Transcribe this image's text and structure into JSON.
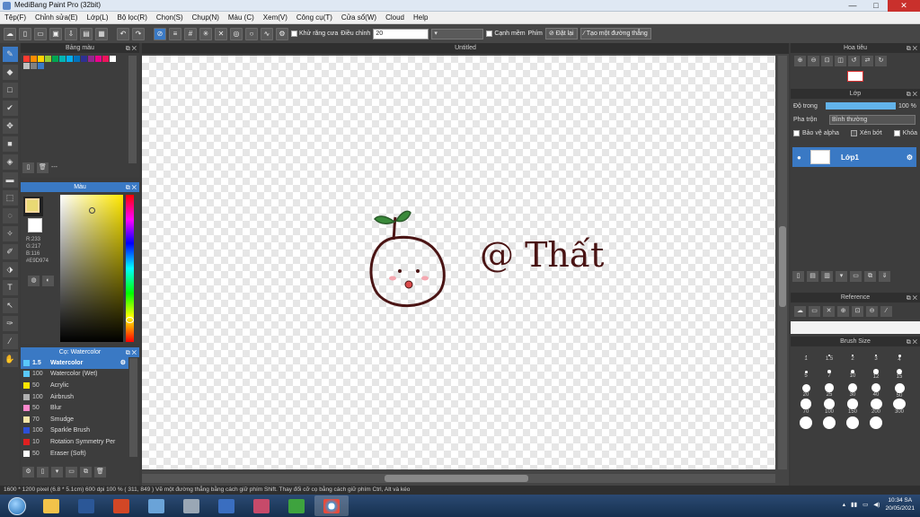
{
  "app": {
    "title": "MediBang Paint Pro (32bit)",
    "win_minimize": "—",
    "win_maximize": "□",
    "win_close": "✕"
  },
  "menu": [
    "Tệp(F)",
    "Chỉnh sửa(E)",
    "Lớp(L)",
    "Bộ lọc(R)",
    "Chọn(S)",
    "Chụp(N)",
    "Màu (C)",
    "Xem(V)",
    "Công cụ(T)",
    "Cửa sổ(W)",
    "Cloud",
    "Help"
  ],
  "toolbar": {
    "antialias_label": "Khử răng cưa",
    "correction_label": "Điều chỉnh",
    "correction_value": "20",
    "edge_label": "Cạnh mềm",
    "key_label": "Phím",
    "reset_label": "Đặt lại",
    "straight_label": "Tạo một đường thẳng"
  },
  "panels": {
    "swatch_title": "Bảng màu",
    "swatch_name": "---",
    "color_title": "Màu",
    "rgb_r": "R:233",
    "rgb_g": "G:217",
    "rgb_b": "B:116",
    "hex": "#E9D974",
    "brush_title": "Cọ: Watercolor",
    "canvas_title": "Untitled",
    "navigator_title": "Hoa tiêu",
    "layer_title": "Lớp",
    "opacity_label": "Độ trong",
    "opacity_value": "100 %",
    "blend_label": "Pha trộn",
    "blend_value": "Bình thường",
    "protect_alpha": "Bảo vệ alpha",
    "clipping": "Xén bớt",
    "lock": "Khóa",
    "layer_name": "Lớp1",
    "reference_title": "Reference",
    "brushsize_title": "Brush Size"
  },
  "swatch_colors": [
    "#ff3b30",
    "#ff8c00",
    "#ffd200",
    "#9acd32",
    "#00a651",
    "#00b4b4",
    "#00aeef",
    "#0072bc",
    "#2e3192",
    "#92278f",
    "#ec008c",
    "#ed145b",
    "#ffffff",
    "#c0c0c0",
    "#808080",
    "#3a79c4"
  ],
  "brushes": [
    {
      "size": "1.5",
      "name": "Watercolor",
      "color": "#5ac8fa",
      "selected": true
    },
    {
      "size": "100",
      "name": "Watercolor (Wet)",
      "color": "#5ac8fa"
    },
    {
      "size": "50",
      "name": "Acrylic",
      "color": "#ffe600"
    },
    {
      "size": "100",
      "name": "Airbrush",
      "color": "#b0b0b0"
    },
    {
      "size": "50",
      "name": "Blur",
      "color": "#ff88cc"
    },
    {
      "size": "70",
      "name": "Smudge",
      "color": "#f5e6a8"
    },
    {
      "size": "100",
      "name": "Sparkle Brush",
      "color": "#2d4fd6"
    },
    {
      "size": "10",
      "name": "Rotation Symmetry Per",
      "color": "#e02020"
    },
    {
      "size": "50",
      "name": "Eraser (Soft)",
      "color": "#ffffff"
    }
  ],
  "brush_sizes": [
    "1",
    "1.5",
    "2",
    "3",
    "4",
    "5",
    "7",
    "10",
    "12",
    "15",
    "20",
    "25",
    "30",
    "40",
    "50",
    "70",
    "100",
    "150",
    "200",
    "300",
    "",
    "",
    "",
    ""
  ],
  "canvas_text": "@ Thất",
  "status": "1600 * 1200 pixel  (6.8 * 5.1cm)  600 dpi  100 %  ( 311, 849 )  Vẽ một đường thẳng bằng cách giữ phím Shift. Thay đổi cỡ cọ bằng cách giữ phím Ctrl, Alt và kéo",
  "clock": {
    "time": "10:34 SA",
    "date": "20/05/2021"
  }
}
